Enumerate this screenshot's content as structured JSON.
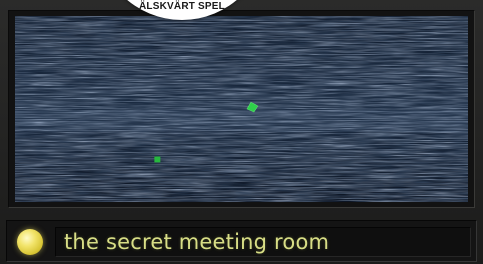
{
  "badge": {
    "text": "ÄLSKVÄRT SPEL"
  },
  "scene": {
    "blips": [
      {
        "name": "green-blip-large",
        "color": "#2fd14a"
      },
      {
        "name": "green-blip-small",
        "color": "#27b83f"
      }
    ]
  },
  "caption": {
    "text": "the secret meeting room",
    "indicator_color": "#e9d94f",
    "text_color": "#d8de86"
  }
}
